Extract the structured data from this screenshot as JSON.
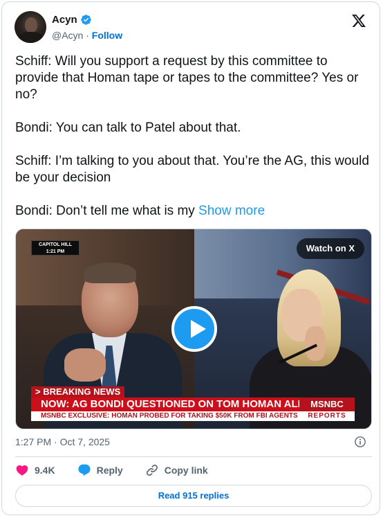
{
  "author": {
    "name": "Acyn",
    "handle": "@Acyn",
    "separator": "·",
    "follow_label": "Follow"
  },
  "tweet": {
    "text": "Schiff: Will you support a request by this committee to provide that Homan tape or tapes to the committee? Yes or no?\n\nBondi: You can talk to Patel about that.\n\nSchiff: I’m talking to you about that. You’re the AG, this would be your decision\n\nBondi: Don’t tell me what is my ",
    "show_more": "Show more"
  },
  "media": {
    "location_line1": "CAPITOL HILL",
    "location_line2": "1:21 PM",
    "watch_label": "Watch on X",
    "breaking_label": "> BREAKING NEWS",
    "headline": "NOW: AG BONDI QUESTIONED ON TOM HOMAN ALLEGATIONS",
    "subline": "MSNBC EXCLUSIVE: HOMAN PROBED FOR TAKING $50K FROM FBI AGENTS",
    "network": "MSNBC",
    "network_tag": "REPORTS"
  },
  "meta": {
    "timestamp": "1:27 PM · Oct 7, 2025"
  },
  "actions": {
    "likes": "9.4K",
    "reply_label": "Reply",
    "copy_label": "Copy link"
  },
  "footer": {
    "read_replies_label": "Read 915 replies"
  },
  "icons": [
    "verified-badge-icon",
    "x-logo-icon",
    "play-icon",
    "info-icon",
    "heart-icon",
    "reply-icon",
    "link-icon"
  ],
  "colors": {
    "accent": "#1d9bf0",
    "link": "#006fd6",
    "like": "#f91880",
    "breaking": "#cc0f1a",
    "text": "#0f1419",
    "muted": "#536471"
  }
}
